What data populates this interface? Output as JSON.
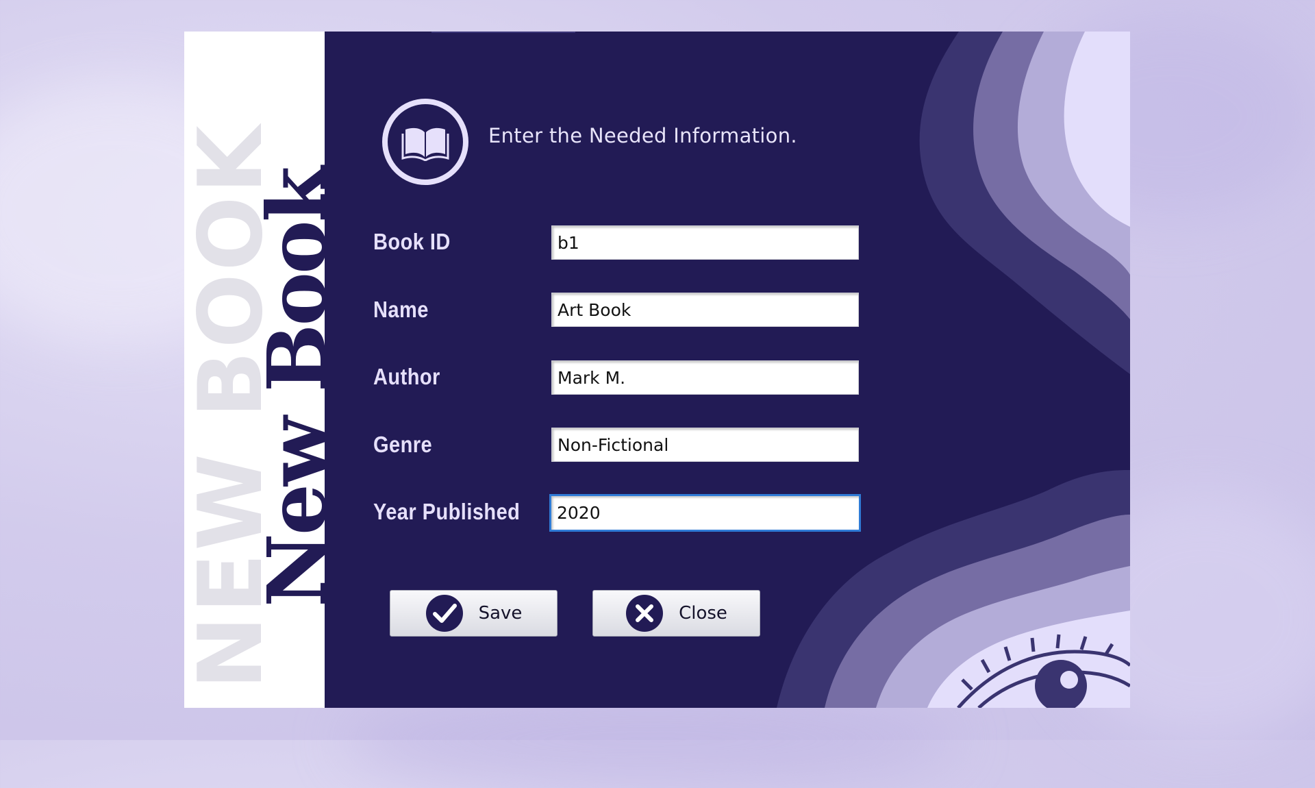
{
  "window": {
    "ghost_title": "NEW BOOK",
    "main_title": "New Book",
    "subtitle": "Enter the Needed Information."
  },
  "icons": {
    "logo": "open-book-icon",
    "save": "checkmark-icon",
    "close": "x-circle-icon",
    "decoration": "eye-icon"
  },
  "form": {
    "fields": [
      {
        "label": "Book ID",
        "value": "b1"
      },
      {
        "label": "Name",
        "value": "Art Book"
      },
      {
        "label": "Author",
        "value": "Mark M."
      },
      {
        "label": "Genre",
        "value": "Non-Fictional"
      },
      {
        "label": "Year Published",
        "value": "2020",
        "focused": true
      }
    ]
  },
  "buttons": {
    "save_label": "Save",
    "close_label": "Close"
  },
  "colors": {
    "panel": "#221b55",
    "accent_light": "#e6e0fb",
    "wave_dark": "#3a3470",
    "wave_mid": "#766da4",
    "wave_light": "#b3acd8",
    "wave_lightest": "#e3defb"
  }
}
